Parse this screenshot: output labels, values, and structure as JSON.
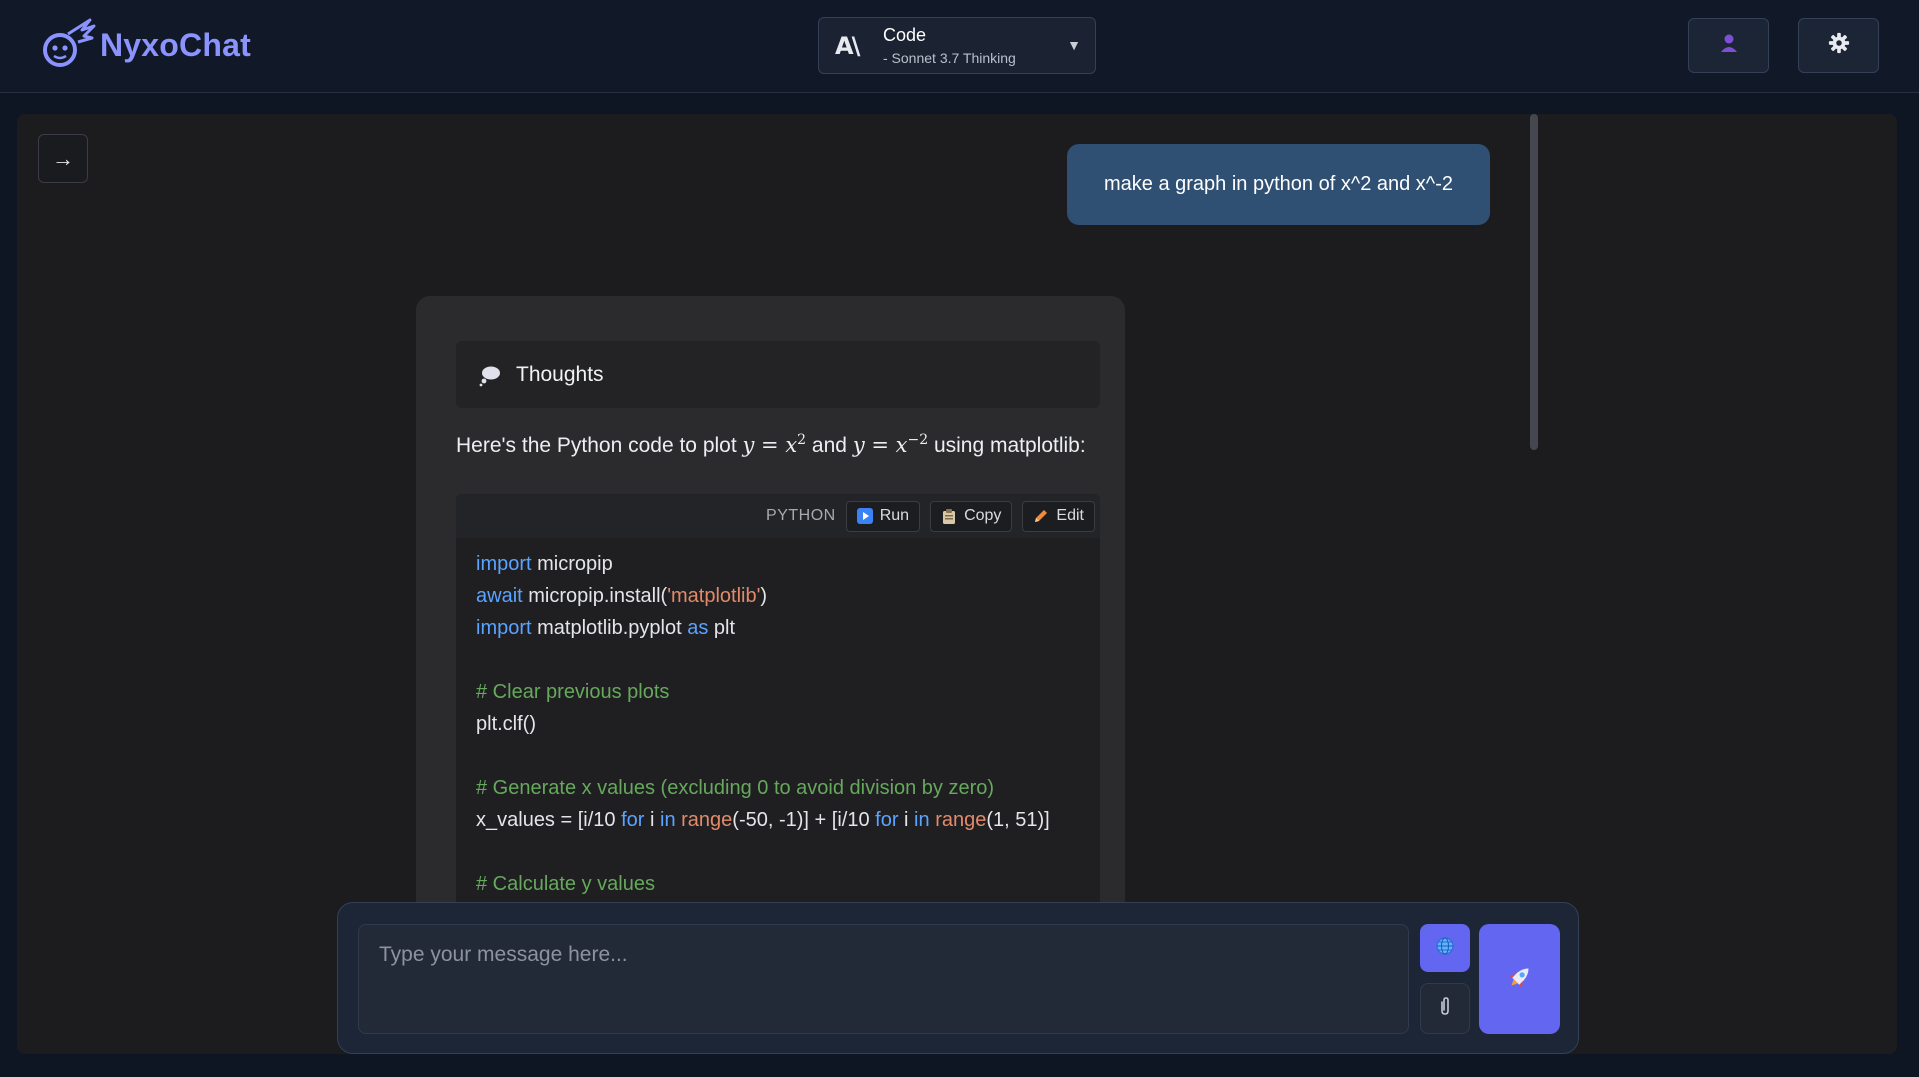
{
  "header": {
    "brand_name": "NyxoChat",
    "model": {
      "name": "Code",
      "subtitle": "- Sonnet 3.7 Thinking",
      "logo_text": "A\\",
      "caret": "▼"
    },
    "user_button_icon": "user-icon",
    "settings_button_icon": "gear-icon"
  },
  "sidebar_toggle": {
    "glyph": "→"
  },
  "conversation": {
    "user_message": "make a graph in python of x^2 and x^-2",
    "assistant": {
      "thoughts_label": "Thoughts",
      "intro_before": "Here's the Python code to plot ",
      "intro_and": " and ",
      "intro_after": " using matplotlib:",
      "math_1": "y = x",
      "math_1_exp": "2",
      "math_2": "y = x",
      "math_2_exp": "−2",
      "code": {
        "language": "PYTHON",
        "run_label": "Run",
        "copy_label": "Copy",
        "edit_label": "Edit",
        "lines": [
          "import micropip",
          "await micropip.install('matplotlib')",
          "import matplotlib.pyplot as plt",
          "",
          "# Clear previous plots",
          "plt.clf()",
          "",
          "# Generate x values (excluding 0 to avoid division by zero)",
          "x_values = [i/10 for i in range(-50, -1)] + [i/10 for i in range(1, 51)]",
          "",
          "# Calculate y values"
        ]
      }
    }
  },
  "composer": {
    "placeholder": "Type your message here...",
    "web_icon": "globe-icon",
    "attach_icon": "paperclip-icon",
    "send_icon": "rocket-icon"
  },
  "colors": {
    "accent": "#6366f1",
    "brand": "#8b93ff",
    "user_bubble": "#2f4f73",
    "keyword": "#5aa3ff",
    "string": "#e28a6a",
    "comment": "#66a85c"
  }
}
